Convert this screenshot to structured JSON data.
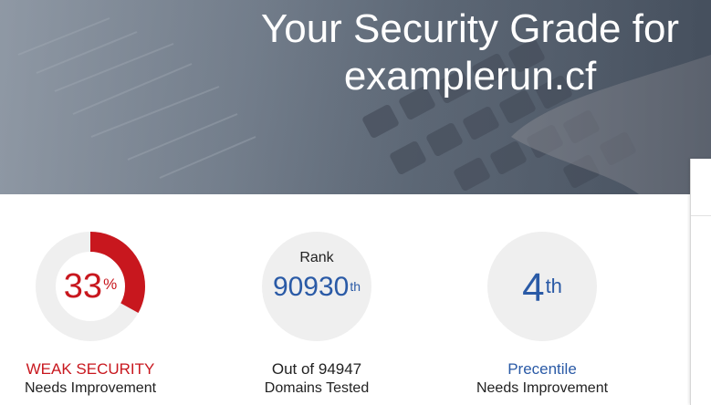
{
  "hero": {
    "title": "Your Security Grade for",
    "domain": "examplerun.cf"
  },
  "grade": {
    "percent": "33",
    "percent_symbol": "%",
    "progress": 0.33,
    "status": "WEAK SECURITY",
    "note": "Needs Improvement",
    "color": "#c8171e"
  },
  "rank": {
    "label": "Rank",
    "value": "90930",
    "suffix": "th",
    "caption": "Out of 94947",
    "note": "Domains Tested",
    "color": "#2a5aa6"
  },
  "percentile": {
    "value": "4",
    "suffix": "th",
    "caption": "Precentile",
    "note": "Needs Improvement",
    "color": "#2a5aa6"
  },
  "icons": {
    "background": "laptop-keyboard-photo"
  }
}
